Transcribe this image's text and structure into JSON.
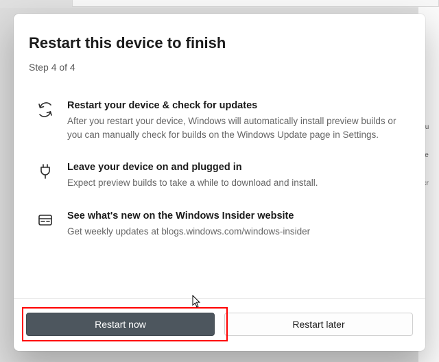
{
  "dialog": {
    "title": "Restart this device to finish",
    "step": "Step 4 of 4",
    "items": [
      {
        "heading": "Restart your device & check for updates",
        "body": "After you restart your device, Windows will automatically install preview builds or you can manually check for builds on the Windows Update page in Settings."
      },
      {
        "heading": "Leave your device on and plugged in",
        "body": "Expect preview builds to take a while to download and install."
      },
      {
        "heading": "See what's new on the Windows Insider website",
        "body": "Get weekly updates at blogs.windows.com/windows-insider"
      }
    ],
    "buttons": {
      "primary": "Restart now",
      "secondary": "Restart later"
    }
  },
  "background": {
    "hint1": "y u",
    "hint2": "we",
    "hint3": "licr"
  }
}
